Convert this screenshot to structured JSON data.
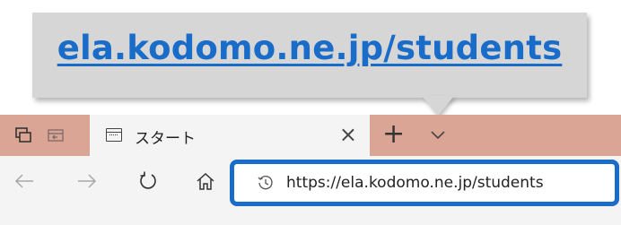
{
  "callout": {
    "text": "ela.kodomo.ne.jp/students",
    "link_color": "#1a6cc9"
  },
  "browser": {
    "tab": {
      "title": "スタート",
      "favicon": "start-page-icon",
      "close_label": "×"
    },
    "new_tab_label": "+",
    "tabbar_color": "#dba595",
    "address": {
      "url": "https://ela.kodomo.ne.jp/students",
      "icon": "history-icon",
      "highlight_color": "#1a6cc9"
    },
    "nav": {
      "back_icon": "back-arrow-icon",
      "forward_icon": "forward-arrow-icon",
      "refresh_icon": "refresh-icon",
      "home_icon": "home-icon"
    }
  }
}
